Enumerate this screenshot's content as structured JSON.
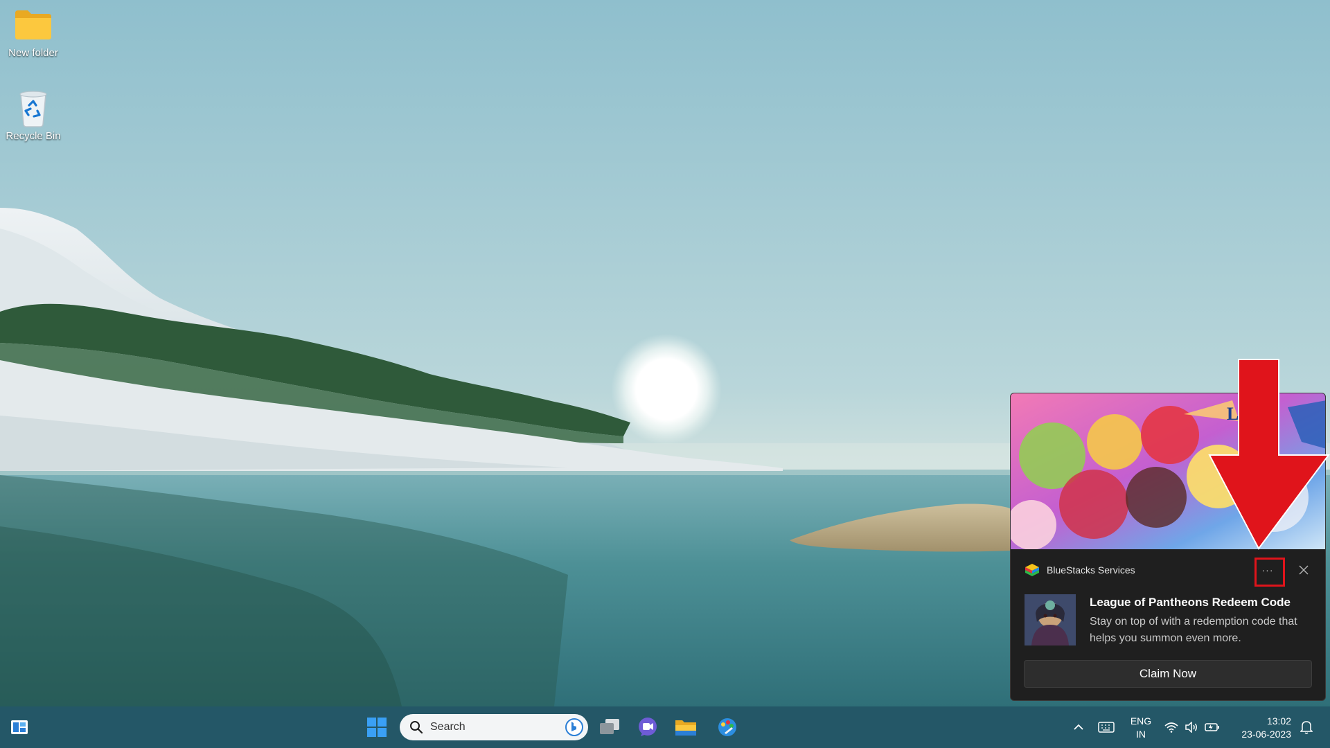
{
  "desktop": {
    "icons": [
      {
        "label": "New folder",
        "icon": "folder-icon"
      },
      {
        "label": "Recycle Bin",
        "icon": "recycle-bin-icon"
      }
    ]
  },
  "taskbar": {
    "search": {
      "placeholder": "Search"
    },
    "apps": [
      "widgets-icon",
      "start-icon",
      "task-view-icon",
      "teams-chat-icon",
      "file-explorer-icon",
      "paint-icon"
    ],
    "tray": {
      "language_line1": "ENG",
      "language_line2": "IN",
      "time": "13:02",
      "date": "23-06-2023"
    }
  },
  "notification": {
    "app_name": "BlueStacks Services",
    "title": "League of Pantheons Redeem Code",
    "body": "Stay on top of with a redemption code that helps you summon even more.",
    "button_label": "Claim Now",
    "more_label": "···"
  },
  "annotation": {
    "color": "#e0141b"
  },
  "colors": {
    "taskbar": "#245767",
    "toast_bg": "#1f1f1f"
  }
}
